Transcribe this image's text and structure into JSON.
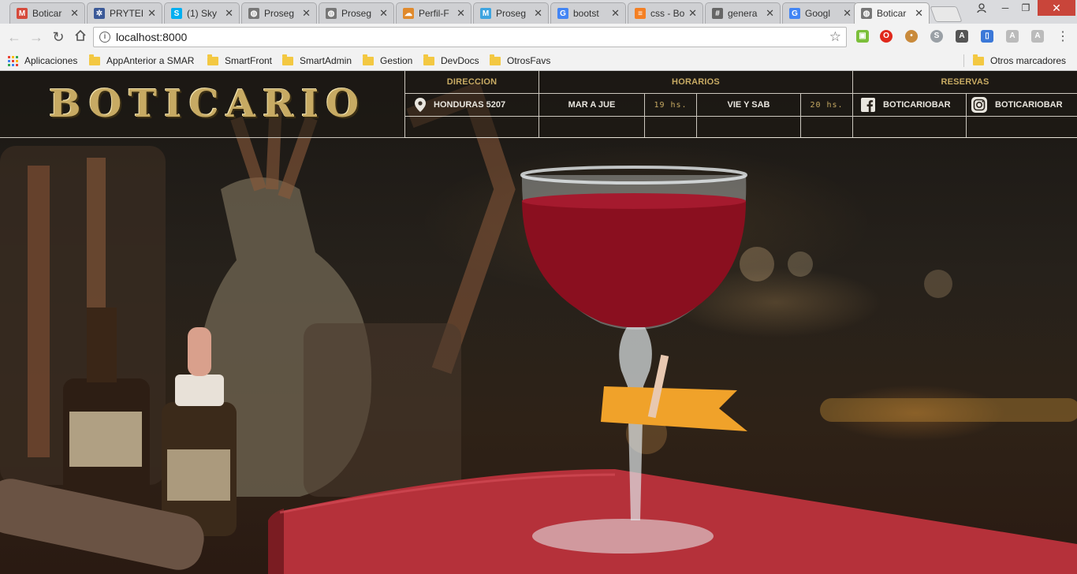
{
  "browser": {
    "tabs": [
      {
        "label": "Boticar",
        "icon": "gmail-icon",
        "color": "#d64a3b",
        "glyph": "M"
      },
      {
        "label": "PRYTEI",
        "icon": "gear-icon",
        "color": "#3b5998",
        "glyph": "✲"
      },
      {
        "label": "(1) Sky",
        "icon": "skype-icon",
        "color": "#00aff0",
        "glyph": "S"
      },
      {
        "label": "Proseg",
        "icon": "globe-icon",
        "color": "#777777",
        "glyph": "◍"
      },
      {
        "label": "Proseg",
        "icon": "globe-icon",
        "color": "#777777",
        "glyph": "◍"
      },
      {
        "label": "Perfil-F",
        "icon": "cloud-icon",
        "color": "#e08a2c",
        "glyph": "☁"
      },
      {
        "label": "Proseg",
        "icon": "m-icon",
        "color": "#3da4e0",
        "glyph": "M"
      },
      {
        "label": "bootst",
        "icon": "google-icon",
        "color": "#4285f4",
        "glyph": "G"
      },
      {
        "label": "css - Bo",
        "icon": "stackoverflow-icon",
        "color": "#f48024",
        "glyph": "≡"
      },
      {
        "label": "genera",
        "icon": "hash-icon",
        "color": "#666666",
        "glyph": "#"
      },
      {
        "label": "Googl",
        "icon": "google-translate-icon",
        "color": "#4285f4",
        "glyph": "G"
      },
      {
        "label": "Boticar",
        "icon": "globe-icon",
        "color": "#777777",
        "glyph": "◍",
        "active": true
      }
    ],
    "url": "localhost:8000",
    "bookmarks": {
      "apps_label": "Aplicaciones",
      "items": [
        "AppAnterior a SMAR",
        "SmartFront",
        "SmartAdmin",
        "Gestion",
        "DevDocs",
        "OtrosFavs"
      ],
      "other": "Otros marcadores"
    }
  },
  "site": {
    "logo": "BOTICARIO",
    "address": {
      "title": "DIRECCION",
      "value": "HONDURAS 5207"
    },
    "hours": {
      "title": "HORARIOS",
      "rows": [
        {
          "days": "MAR A JUE",
          "time": "19 hs."
        },
        {
          "days": "VIE Y SAB",
          "time": "20 hs."
        }
      ]
    },
    "reservations": {
      "title": "RESERVAS",
      "facebook": "BOTICARIOBAR",
      "instagram": "BOTICARIOBAR"
    },
    "colors": {
      "gold": "#c7aa63",
      "text": "#e9e6df"
    }
  }
}
